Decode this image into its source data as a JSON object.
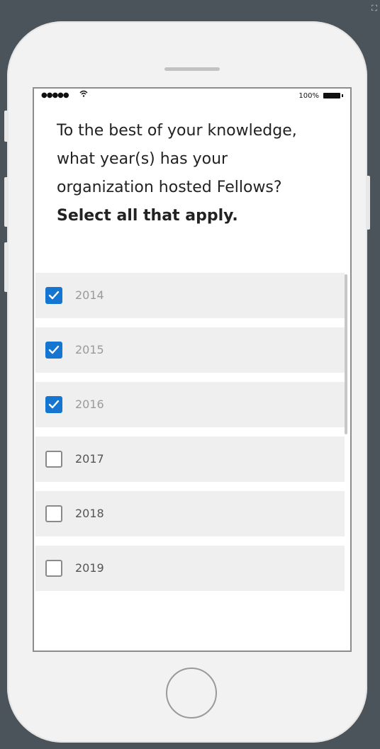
{
  "status_bar": {
    "signal": "●●●●●",
    "battery_text": "100%"
  },
  "question": {
    "text_regular": "To the best of your knowledge, what year(s) has your organization hosted Fellows?",
    "text_bold": "Select all that apply."
  },
  "options": [
    {
      "label": "2014",
      "checked": true
    },
    {
      "label": "2015",
      "checked": true
    },
    {
      "label": "2016",
      "checked": true
    },
    {
      "label": "2017",
      "checked": false
    },
    {
      "label": "2018",
      "checked": false
    },
    {
      "label": "2019",
      "checked": false
    }
  ],
  "colors": {
    "checked": "#1476d1",
    "option_bg": "#efefef",
    "background": "#4b545b"
  },
  "icons": {
    "corner": "selection-icon",
    "wifi": "wifi-icon",
    "battery": "battery-icon",
    "check": "check-icon"
  }
}
